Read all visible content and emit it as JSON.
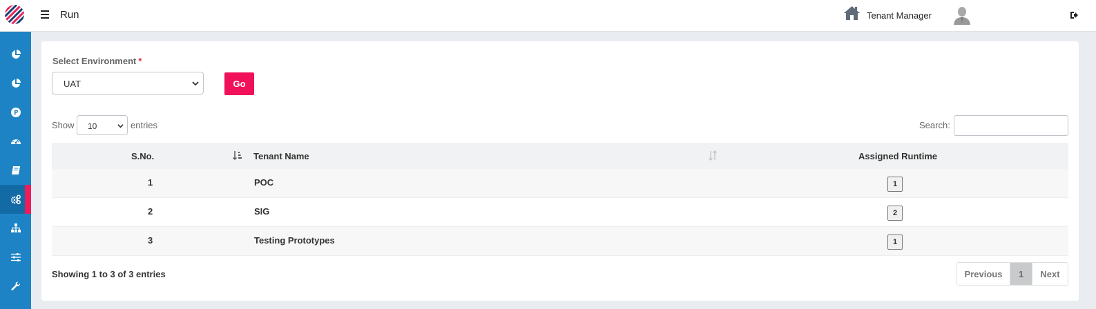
{
  "header": {
    "page_title": "Run",
    "tenant_manager": "Tenant Manager"
  },
  "sidebar": {
    "items": [
      {
        "icon": "pie-chart-icon"
      },
      {
        "icon": "pie-chart-icon"
      },
      {
        "icon": "parking-icon"
      },
      {
        "icon": "dashboard-icon"
      },
      {
        "icon": "book-icon"
      },
      {
        "icon": "cogs-icon",
        "active": true
      },
      {
        "icon": "sitemap-icon"
      },
      {
        "icon": "sliders-icon"
      },
      {
        "icon": "wrench-icon"
      }
    ]
  },
  "form": {
    "env_label": "Select Environment",
    "required_mark": "*",
    "env_value": "UAT",
    "go_label": "Go"
  },
  "table_controls": {
    "show_label": "Show",
    "page_length": "10",
    "entries_label": "entries",
    "search_label": "Search:",
    "search_value": ""
  },
  "table": {
    "columns": [
      "S.No.",
      "Tenant Name",
      "Assigned Runtime"
    ],
    "rows": [
      {
        "sno": "1",
        "tenant": "POC",
        "runtime": "1"
      },
      {
        "sno": "2",
        "tenant": "SIG",
        "runtime": "2"
      },
      {
        "sno": "3",
        "tenant": "Testing Prototypes",
        "runtime": "1"
      }
    ]
  },
  "footer": {
    "info": "Showing 1 to 3 of 3 entries",
    "prev": "Previous",
    "page": "1",
    "next": "Next"
  },
  "colors": {
    "sidebar": "#1d83c5",
    "accent": "#f0115a"
  }
}
